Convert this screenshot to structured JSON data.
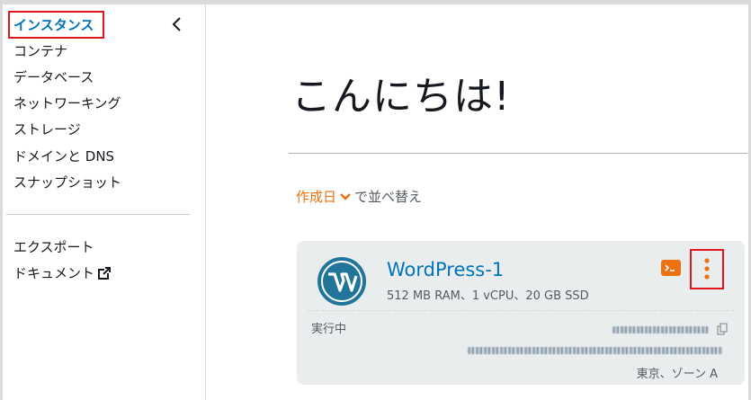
{
  "sidebar": {
    "items": [
      {
        "label": "インスタンス",
        "active": true
      },
      {
        "label": "コンテナ"
      },
      {
        "label": "データベース"
      },
      {
        "label": "ネットワーキング"
      },
      {
        "label": "ストレージ"
      },
      {
        "label": "ドメインと DNS"
      },
      {
        "label": "スナップショット"
      }
    ],
    "secondary": [
      {
        "label": "エクスポート"
      },
      {
        "label": "ドキュメント",
        "icon": "external-link-icon"
      }
    ],
    "collapse_icon": "chevron-left-icon"
  },
  "main": {
    "greeting": "こんにちは!",
    "sort": {
      "label": "作成日",
      "suffix": "で並べ替え"
    }
  },
  "instance": {
    "name": "WordPress-1",
    "spec": "512 MB RAM、1 vCPU、20 GB SSD",
    "status": "実行中",
    "zone": "東京、ゾーン A",
    "logo_icon": "wordpress-logo-icon",
    "ssh_icon": "terminal-icon",
    "menu_icon": "vertical-ellipsis-icon"
  },
  "colors": {
    "accent_orange": "#ec7211",
    "link_blue": "#0073bb",
    "highlight_red": "#e0141b",
    "card_bg": "#eaeded"
  }
}
